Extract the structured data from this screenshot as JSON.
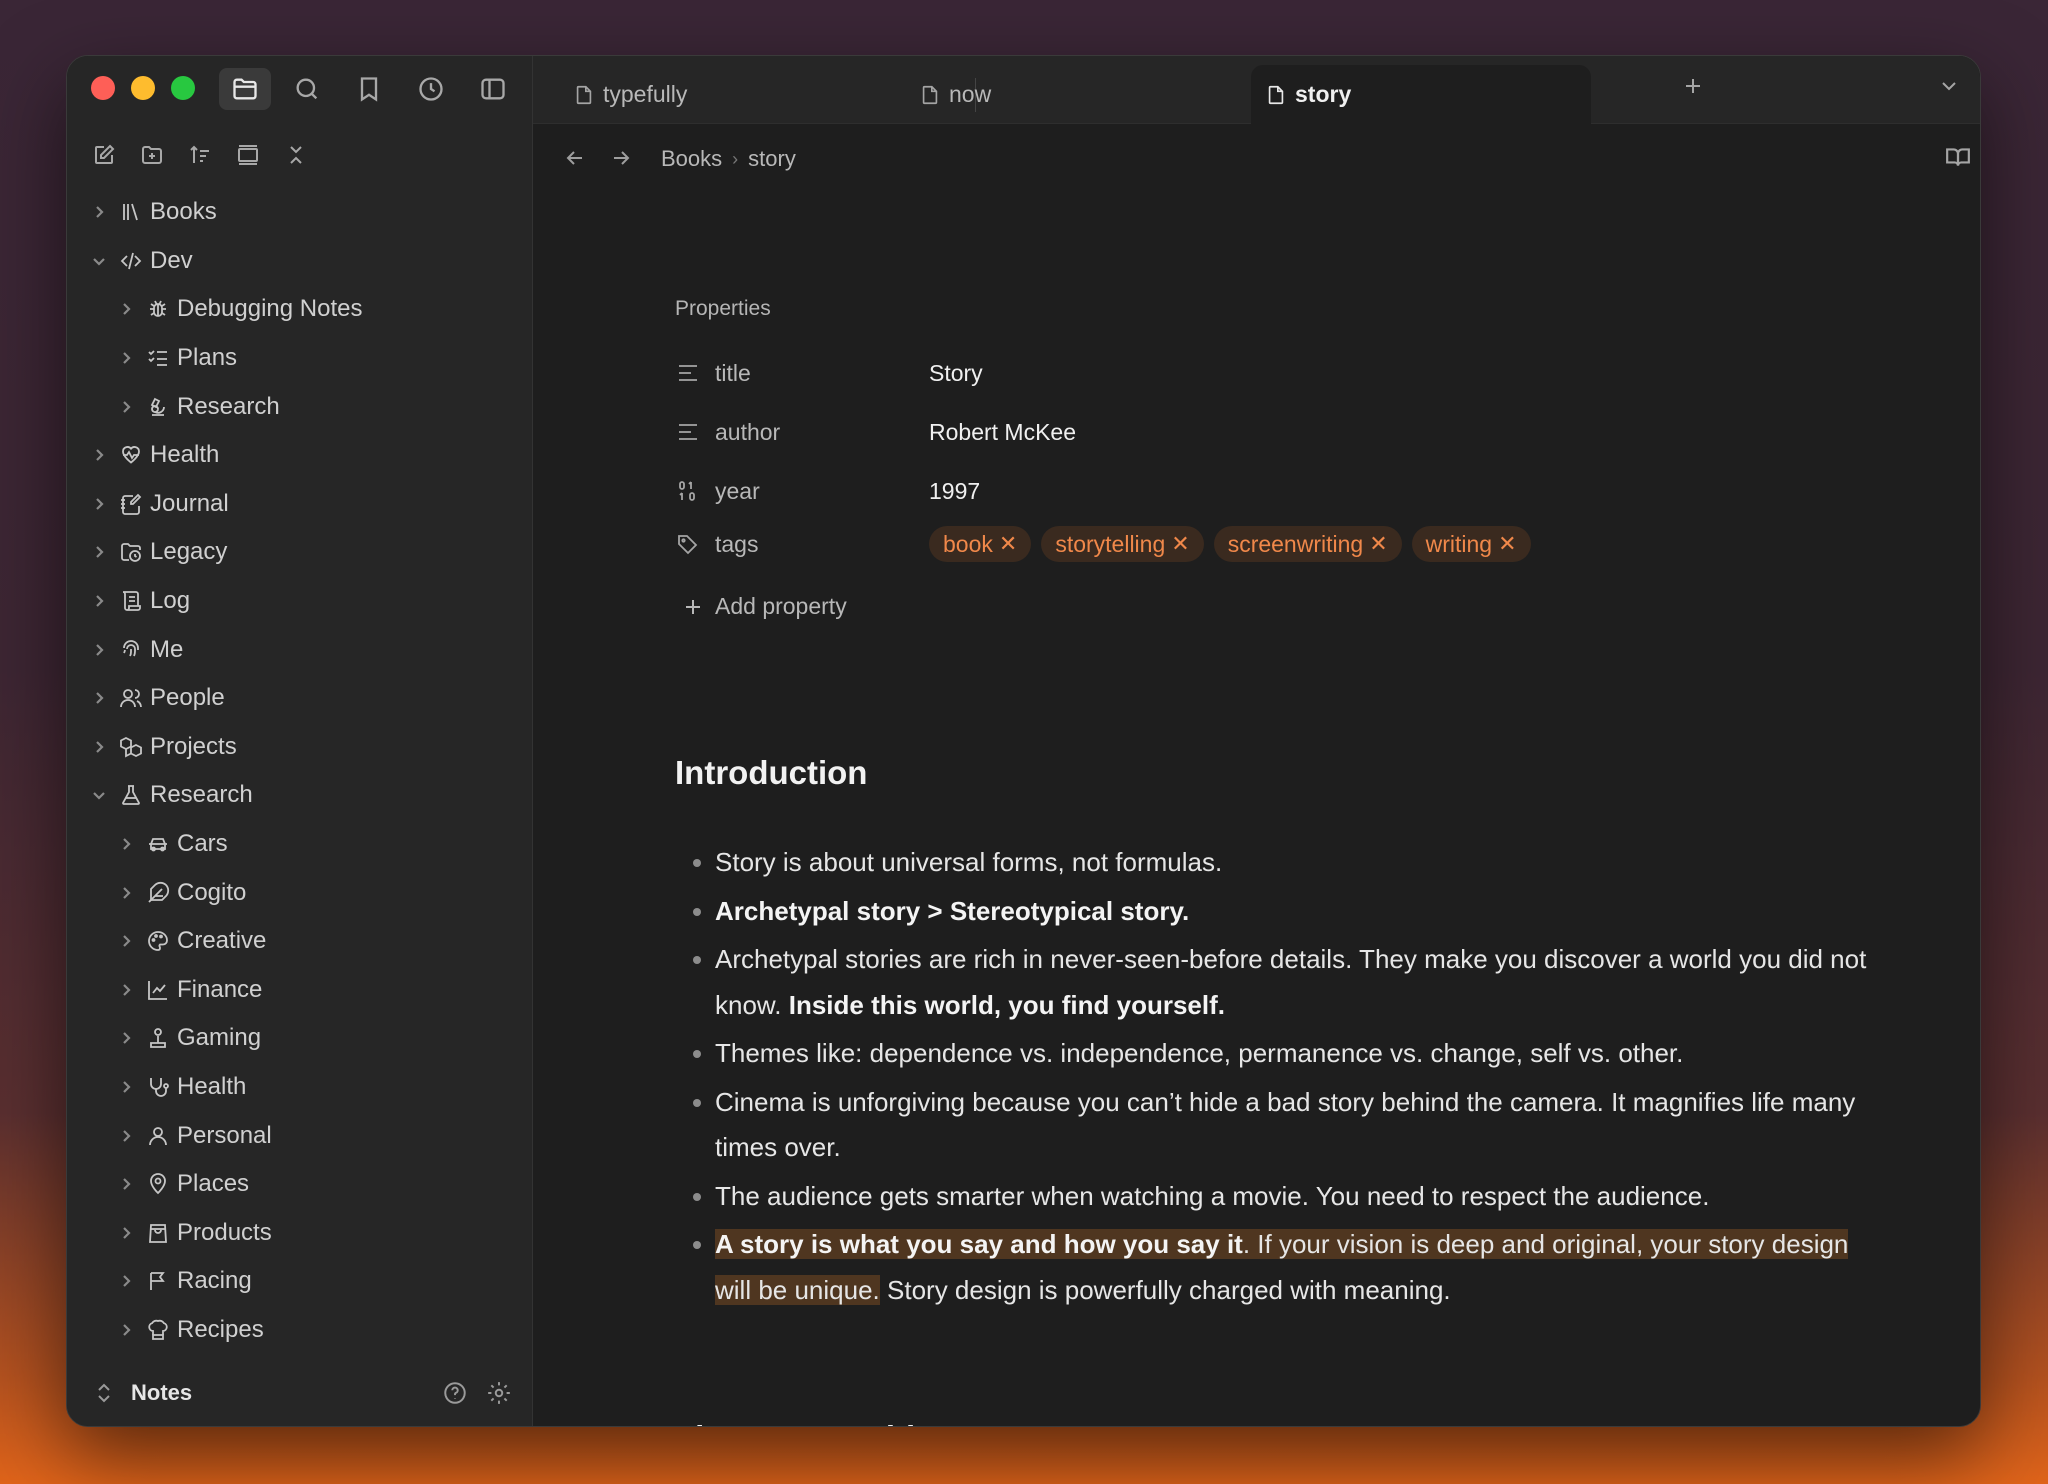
{
  "sidebar": {
    "tree": [
      {
        "label": "Books",
        "icon": "library-icon",
        "level": 0,
        "expanded": false
      },
      {
        "label": "Dev",
        "icon": "code-icon",
        "level": 0,
        "expanded": true
      },
      {
        "label": "Debugging Notes",
        "icon": "bug-icon",
        "level": 1,
        "expanded": false
      },
      {
        "label": "Plans",
        "icon": "list-checks-icon",
        "level": 1,
        "expanded": false
      },
      {
        "label": "Research",
        "icon": "microscope-icon",
        "level": 1,
        "expanded": false
      },
      {
        "label": "Health",
        "icon": "heart-pulse-icon",
        "level": 0,
        "expanded": false
      },
      {
        "label": "Journal",
        "icon": "notebook-pen-icon",
        "level": 0,
        "expanded": false
      },
      {
        "label": "Legacy",
        "icon": "folder-clock-icon",
        "level": 0,
        "expanded": false
      },
      {
        "label": "Log",
        "icon": "scroll-icon",
        "level": 0,
        "expanded": false
      },
      {
        "label": "Me",
        "icon": "fingerprint-icon",
        "level": 0,
        "expanded": false
      },
      {
        "label": "People",
        "icon": "users-icon",
        "level": 0,
        "expanded": false
      },
      {
        "label": "Projects",
        "icon": "boxes-icon",
        "level": 0,
        "expanded": false
      },
      {
        "label": "Research",
        "icon": "flask-icon",
        "level": 0,
        "expanded": true
      },
      {
        "label": "Cars",
        "icon": "car-icon",
        "level": 1,
        "expanded": false
      },
      {
        "label": "Cogito",
        "icon": "feather-icon",
        "level": 1,
        "expanded": false
      },
      {
        "label": "Creative",
        "icon": "palette-icon",
        "level": 1,
        "expanded": false
      },
      {
        "label": "Finance",
        "icon": "line-chart-icon",
        "level": 1,
        "expanded": false
      },
      {
        "label": "Gaming",
        "icon": "joystick-icon",
        "level": 1,
        "expanded": false
      },
      {
        "label": "Health",
        "icon": "stethoscope-icon",
        "level": 1,
        "expanded": false
      },
      {
        "label": "Personal",
        "icon": "user-icon",
        "level": 1,
        "expanded": false
      },
      {
        "label": "Places",
        "icon": "map-pin-icon",
        "level": 1,
        "expanded": false
      },
      {
        "label": "Products",
        "icon": "shopping-bag-icon",
        "level": 1,
        "expanded": false
      },
      {
        "label": "Racing",
        "icon": "flag-icon",
        "level": 1,
        "expanded": false
      },
      {
        "label": "Recipes",
        "icon": "chef-hat-icon",
        "level": 1,
        "expanded": false
      }
    ],
    "vault_name": "Notes"
  },
  "tabs": [
    {
      "label": "typefully",
      "active": false
    },
    {
      "label": "now",
      "active": false
    },
    {
      "label": "story",
      "active": true
    }
  ],
  "breadcrumb": {
    "parent": "Books",
    "separator": "›",
    "current": "story"
  },
  "properties": {
    "heading": "Properties",
    "rows": [
      {
        "name": "title",
        "value": "Story",
        "icon": "text-lines-icon"
      },
      {
        "name": "author",
        "value": "Robert McKee",
        "icon": "text-lines-icon"
      },
      {
        "name": "year",
        "value": "1997",
        "icon": "binary-icon"
      }
    ],
    "tags_name": "tags",
    "tags": [
      "book",
      "storytelling",
      "screenwriting",
      "writing"
    ],
    "tag_remove_glyph": "✕",
    "add_label": "Add property"
  },
  "note": {
    "heading_intro": "Introduction",
    "bullets": [
      {
        "parts": [
          {
            "t": "Story is about universal forms, not formulas."
          }
        ]
      },
      {
        "parts": [
          {
            "t": "Archetypal story > Stereotypical story.",
            "b": true
          }
        ]
      },
      {
        "parts": [
          {
            "t": "Archetypal stories are rich in never-seen-before details. They make you discover a world you did not know. "
          },
          {
            "t": "Inside this world, you find yourself.",
            "b": true
          }
        ]
      },
      {
        "parts": [
          {
            "t": "Themes like: dependence vs. independence, permanence vs. change, self vs. other."
          }
        ]
      },
      {
        "parts": [
          {
            "t": "Cinema is unforgiving because you can’t hide a bad story behind the camera. It magnifies life many times over."
          }
        ]
      },
      {
        "parts": [
          {
            "t": "The audience gets smarter when watching a movie. You need to respect the audience."
          }
        ]
      },
      {
        "parts": [
          {
            "t": "A story is what you say and how you say it",
            "b": true,
            "hl": true
          },
          {
            "t": ". If your vision is deep and original, your story design will be unique.",
            "hl": true
          },
          {
            "t": " Story design is powerfully charged with meaning."
          }
        ]
      }
    ],
    "heading_problem": "The story problem"
  },
  "colors": {
    "accent_tag": "#f0884a",
    "highlight": "#4f3620"
  }
}
